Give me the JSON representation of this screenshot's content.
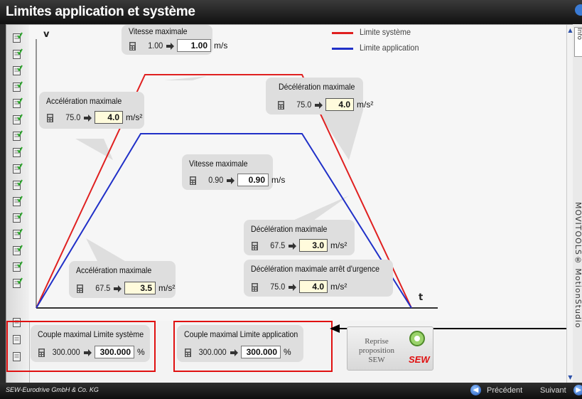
{
  "window": {
    "title": "Limites application et système"
  },
  "chart": {
    "y_axis_label": "v",
    "x_axis_label": "t",
    "legend": [
      {
        "label": "Limite système",
        "color": "#e02020"
      },
      {
        "label": "Limite application",
        "color": "#2030c8"
      }
    ]
  },
  "system_limits": {
    "max_speed": {
      "label": "Vitesse maximale",
      "old": "1.00",
      "value": "1.00",
      "unit": "m/s"
    },
    "max_accel": {
      "label": "Accélération maximale",
      "old": "75.0",
      "value": "4.0",
      "unit": "m/s²"
    },
    "max_decel": {
      "label": "Décélération maximale",
      "old": "75.0",
      "value": "4.0",
      "unit": "m/s²"
    },
    "max_torque": {
      "label": "Couple maximal Limite système",
      "old": "300.000",
      "value": "300.000",
      "unit": "%"
    }
  },
  "application_limits": {
    "max_speed": {
      "label": "Vitesse maximale",
      "old": "0.90",
      "value": "0.90",
      "unit": "m/s"
    },
    "max_accel": {
      "label": "Accélération maximale",
      "old": "67.5",
      "value": "3.5",
      "unit": "m/s²"
    },
    "max_decel": {
      "label": "Décélération maximale",
      "old": "67.5",
      "value": "3.0",
      "unit": "m/s²"
    },
    "emergency_decel": {
      "label": "Décélération maximale arrêt d'urgence",
      "old": "75.0",
      "value": "4.0",
      "unit": "m/s²"
    },
    "max_torque": {
      "label": "Couple maximal Limite application",
      "old": "300.000",
      "value": "300.000",
      "unit": "%"
    }
  },
  "sew_button": {
    "label": "Reprise proposition SEW",
    "logo": "SEW"
  },
  "footer": {
    "copyright": "SEW-Eurodrive GmbH & Co. KG",
    "prev_label": "Précédent",
    "next_label": "Suivant"
  },
  "sidebar_text": "MOVITOOLS® MotionStudio",
  "sidebar_tab": "Info",
  "sidebar_icons": {
    "checked_count": 16,
    "plain_count": 3
  }
}
